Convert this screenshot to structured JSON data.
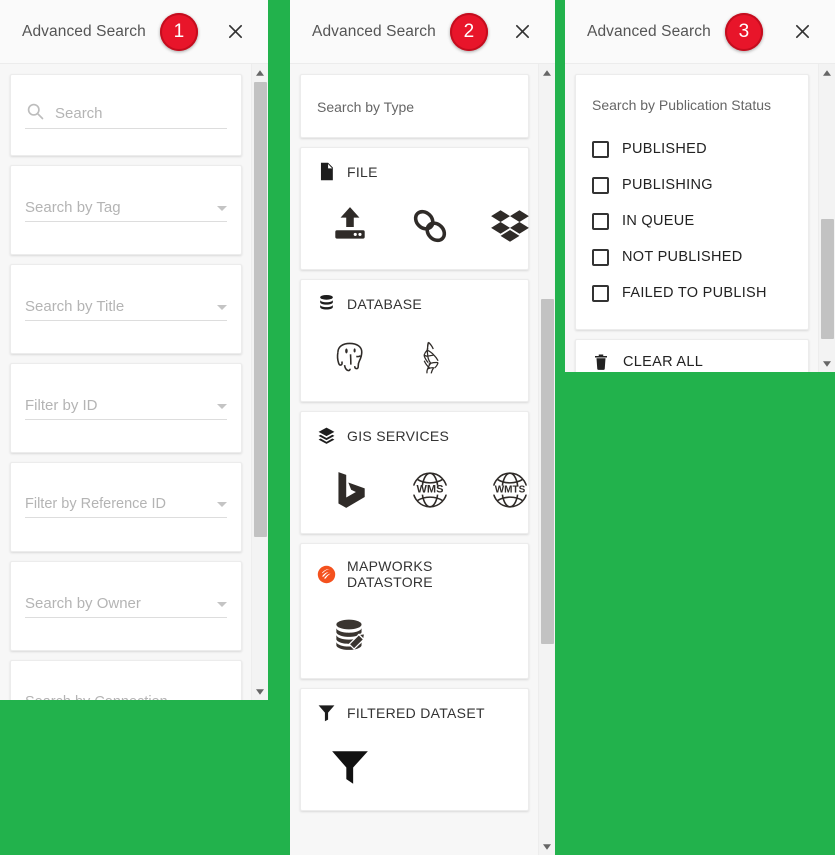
{
  "background_color": "#22b24c",
  "panels": [
    {
      "title": "Advanced Search",
      "badge": "1",
      "close_icon": "close-icon",
      "fields": [
        {
          "placeholder": "Search",
          "icon": "search-icon",
          "has_caret": false
        },
        {
          "placeholder": "Search by Tag",
          "icon": null,
          "has_caret": true
        },
        {
          "placeholder": "Search by Title",
          "icon": null,
          "has_caret": true
        },
        {
          "placeholder": "Filter by ID",
          "icon": null,
          "has_caret": true
        },
        {
          "placeholder": "Filter by Reference ID",
          "icon": null,
          "has_caret": true
        },
        {
          "placeholder": "Search by Owner",
          "icon": null,
          "has_caret": true
        },
        {
          "placeholder": "Search by Connection",
          "icon": null,
          "has_caret": true
        }
      ]
    },
    {
      "title": "Advanced Search",
      "badge": "2",
      "close_icon": "close-icon",
      "section_heading": "Search by Type",
      "type_groups": [
        {
          "label": "FILE",
          "icon": "file-icon",
          "options": [
            {
              "name": "upload-icon"
            },
            {
              "name": "link-icon"
            },
            {
              "name": "dropbox-icon"
            }
          ]
        },
        {
          "label": "DATABASE",
          "icon": "database-icon",
          "options": [
            {
              "name": "postgresql-icon"
            },
            {
              "name": "sql-server-icon"
            }
          ]
        },
        {
          "label": "GIS SERVICES",
          "icon": "layers-icon",
          "options": [
            {
              "name": "bing-maps-icon"
            },
            {
              "name": "wms-icon",
              "text": "WMS"
            },
            {
              "name": "wmts-icon",
              "text": "WMTS"
            }
          ]
        },
        {
          "label": "MAPWORKS DATASTORE",
          "icon": "mapworks-logo-icon",
          "options": [
            {
              "name": "datastore-edit-icon"
            }
          ]
        },
        {
          "label": "FILTERED DATASET",
          "icon": "filter-icon",
          "options": [
            {
              "name": "funnel-icon"
            }
          ]
        }
      ]
    },
    {
      "title": "Advanced Search",
      "badge": "3",
      "close_icon": "close-icon",
      "section_heading": "Search by Publication Status",
      "statuses": [
        {
          "label": "PUBLISHED",
          "checked": false
        },
        {
          "label": "PUBLISHING",
          "checked": false
        },
        {
          "label": "IN QUEUE",
          "checked": false
        },
        {
          "label": "NOT PUBLISHED",
          "checked": false
        },
        {
          "label": "FAILED TO PUBLISH",
          "checked": false
        }
      ],
      "clear_all": {
        "label": "CLEAR ALL",
        "icon": "trash-icon"
      }
    }
  ]
}
